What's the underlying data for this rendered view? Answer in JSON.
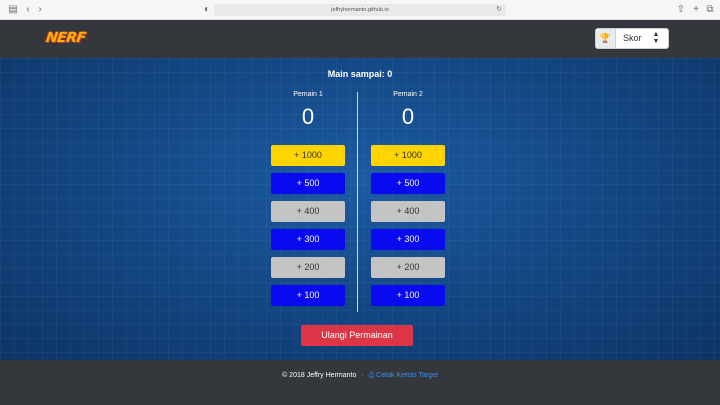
{
  "browser": {
    "url": "jeffryhermanto.github.io"
  },
  "nav": {
    "logo": "NERF",
    "select": {
      "icon": "trophy-icon",
      "value": "Skor"
    }
  },
  "game": {
    "play_to_label": "Main sampai:",
    "play_to_value": "0",
    "players": [
      {
        "name": "Pemain 1",
        "score": "0"
      },
      {
        "name": "Pemain 2",
        "score": "0"
      }
    ],
    "buttons": [
      "+ 1000",
      "+ 500",
      "+ 400",
      "+ 300",
      "+ 200",
      "+ 100"
    ],
    "reset_label": "Ulangi Permainan"
  },
  "footer": {
    "copyright": "© 2018 Jeffry Hermanto",
    "separator": "·",
    "link_text": "Cetak Kertas Target"
  },
  "colors": {
    "accent_yellow": "#ffd400",
    "accent_blue": "#0a0af0",
    "neutral_gray": "#c4c4c4",
    "danger": "#dc3545",
    "link": "#3b8ef0"
  }
}
